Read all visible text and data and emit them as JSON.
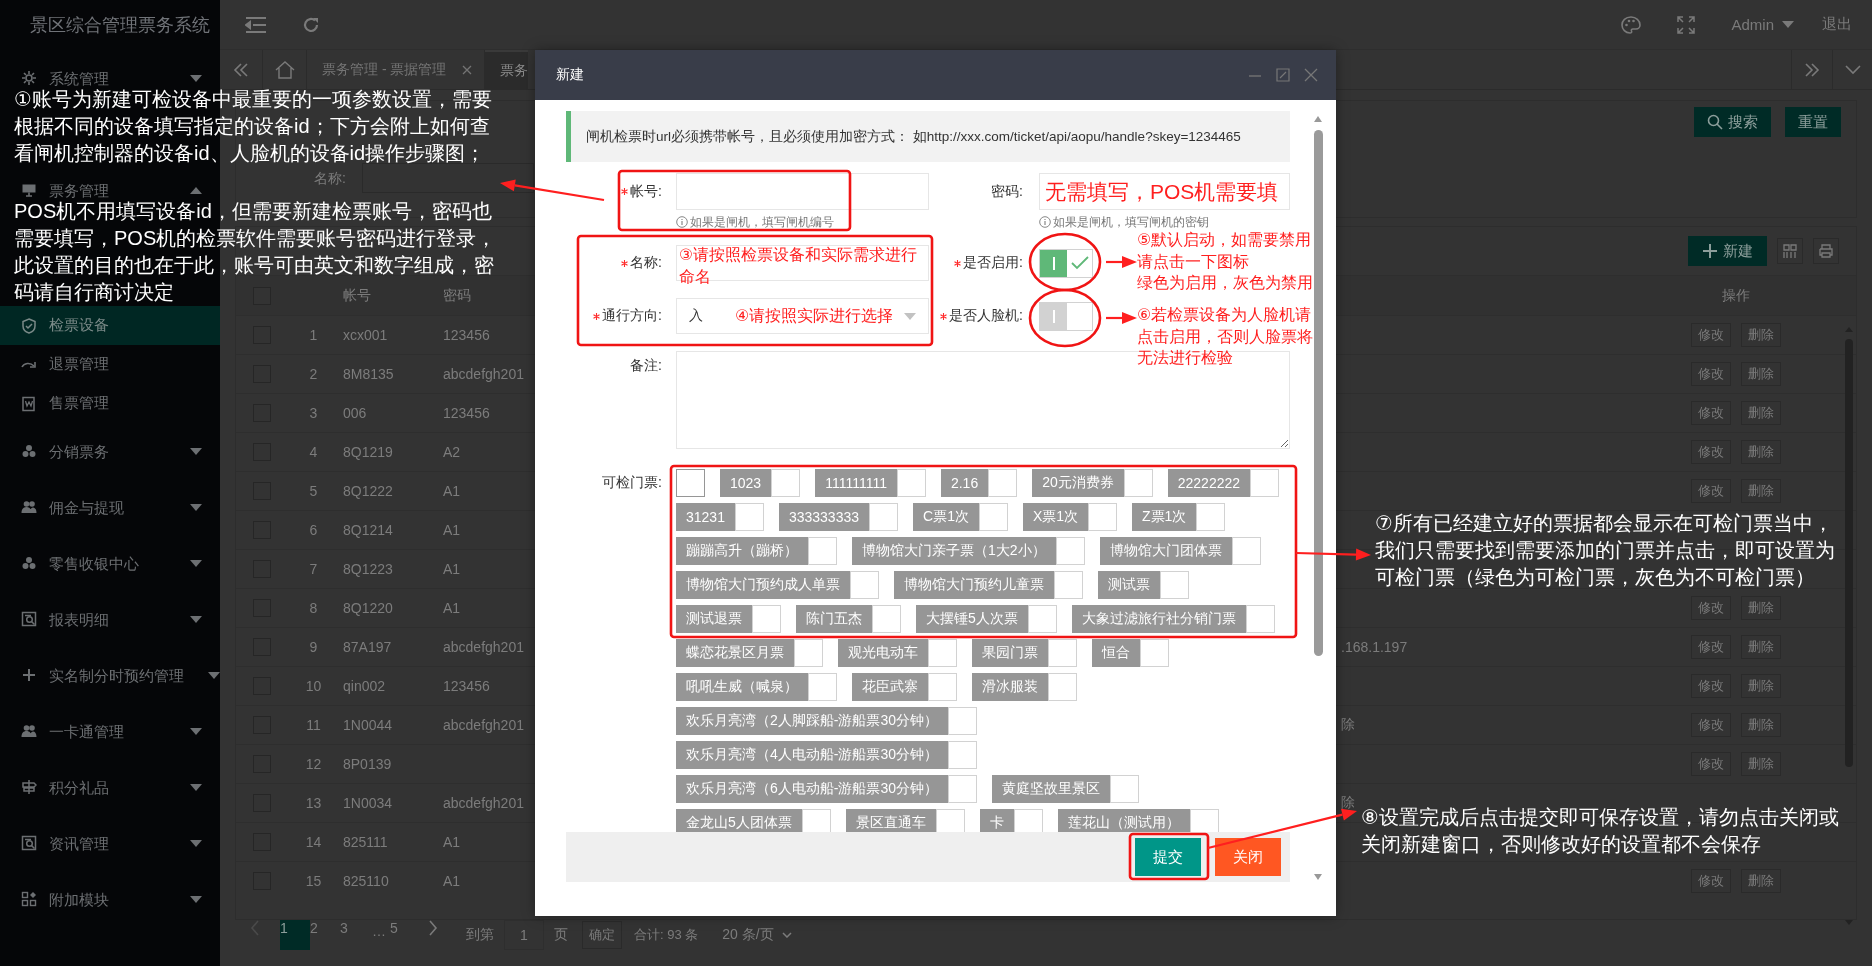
{
  "app": {
    "title": "景区综合管理票务系统"
  },
  "sidebar": {
    "items": [
      {
        "label": "系统管理",
        "expanded": false,
        "selected": false
      },
      {
        "label": "票务管理",
        "expanded": true,
        "selected": false,
        "children": [
          {
            "label": "检票设备",
            "selected": true
          },
          {
            "label": "退票管理",
            "selected": false
          },
          {
            "label": "售票管理",
            "selected": false
          }
        ]
      },
      {
        "label": "分销票务",
        "expanded": false,
        "selected": false
      },
      {
        "label": "佣金与提现",
        "expanded": false,
        "selected": false
      },
      {
        "label": "零售收银中心",
        "expanded": false,
        "selected": false
      },
      {
        "label": "报表明细",
        "expanded": false,
        "selected": false
      },
      {
        "label": "实名制分时预约管理",
        "expanded": false,
        "selected": false
      },
      {
        "label": "一卡通管理",
        "expanded": false,
        "selected": false
      },
      {
        "label": "积分礼品",
        "expanded": false,
        "selected": false
      },
      {
        "label": "资讯管理",
        "expanded": false,
        "selected": false
      },
      {
        "label": "附加模块",
        "expanded": false,
        "selected": false
      }
    ]
  },
  "header": {
    "user": "Admin",
    "logout": "退出"
  },
  "tabs": [
    {
      "label": "票务管理 - 票据管理",
      "selected": false
    },
    {
      "label": "票务",
      "selected": true
    }
  ],
  "search": {
    "label": "名称:",
    "buttons": [
      "搜索",
      "重置"
    ]
  },
  "toolbar": {
    "new_button": "新建"
  },
  "table": {
    "columns": [
      "帐号",
      "密码",
      "操作"
    ],
    "all_checked": false,
    "rows": [
      {
        "index": "1",
        "account": "xcx001",
        "password": "123456",
        "checked": false,
        "actions": [
          "修改",
          "删除"
        ]
      },
      {
        "index": "2",
        "account": "8M8135",
        "password": "abcdefgh201",
        "checked": false,
        "actions": [
          "修改",
          "删除"
        ]
      },
      {
        "index": "3",
        "account": "006",
        "password": "123456",
        "checked": false,
        "actions": [
          "修改",
          "删除"
        ]
      },
      {
        "index": "4",
        "account": "8Q1219",
        "password": "A2",
        "checked": false,
        "actions": [
          "修改",
          "删除"
        ]
      },
      {
        "index": "5",
        "account": "8Q1222",
        "password": "A1",
        "checked": false,
        "actions": [
          "修改",
          "删除"
        ]
      },
      {
        "index": "6",
        "account": "8Q1214",
        "password": "A1",
        "checked": false
      },
      {
        "index": "7",
        "account": "8Q1223",
        "password": "A1",
        "checked": false
      },
      {
        "index": "8",
        "account": "8Q1220",
        "password": "A1",
        "checked": false,
        "actions": [
          "修改",
          "删除"
        ]
      },
      {
        "index": "9",
        "account": "87A197",
        "password": "abcdefgh201",
        "column_5": ".168.1.197",
        "checked": false,
        "actions": [
          "修改",
          "删除"
        ]
      },
      {
        "index": "10",
        "account": "qin002",
        "password": "123456",
        "checked": false,
        "actions": [
          "修改",
          "删除"
        ]
      },
      {
        "index": "11",
        "account": "1N0044",
        "password": "abcdefgh201",
        "column_5": "除",
        "checked": false,
        "actions": [
          "修改",
          "删除"
        ]
      },
      {
        "index": "12",
        "account": "8P0139",
        "checked": false,
        "actions": [
          "修改",
          "删除"
        ]
      },
      {
        "index": "13",
        "account": "1N0034",
        "password": "abcdefgh201",
        "column_5": "除",
        "checked": false
      },
      {
        "index": "14",
        "account": "825111",
        "password": "A1",
        "checked": false
      },
      {
        "index": "15",
        "account": "825110",
        "password": "A1",
        "checked": false,
        "actions": [
          "修改",
          "删除"
        ]
      }
    ]
  },
  "pagination": {
    "pages": [
      {
        "label": "1",
        "kind": "page",
        "selected": true
      },
      {
        "label": "2",
        "kind": "page",
        "selected": false
      },
      {
        "label": "3",
        "kind": "page",
        "selected": false
      },
      {
        "label": "…",
        "kind": "ellipsis",
        "selected": false
      },
      {
        "label": "5",
        "kind": "page",
        "selected": false
      }
    ],
    "goto_label": "到第",
    "goto_value": "1",
    "goto_unit": "页",
    "confirm": "确定",
    "total": "合计: 93 条",
    "page_size": "20 条/页"
  },
  "dialog": {
    "title": "新建",
    "notice": "闸机检票时url必须携带帐号，且必须使用加密方式： 如http://xxx.com/ticket/api/aopu/handle?skey=1234465",
    "account": {
      "label": "帐号:",
      "required": true,
      "hint": "如果是闸机，填写闸机编号"
    },
    "password": {
      "label": "密码:",
      "required": false,
      "hint": "如果是闸机，填写闸机的密钥",
      "note": "无需填写，POS机需要填"
    },
    "name": {
      "label": "名称:",
      "required": true,
      "note": "③请按照检票设备和实际需求进行命名"
    },
    "direction": {
      "label": "通行方向:",
      "required": true,
      "value": "入",
      "note": "④请按照实际进行选择"
    },
    "enabled": {
      "label": "是否启用:",
      "required": true,
      "on": true
    },
    "face": {
      "label": "是否人脸机:",
      "required": true,
      "on": false
    },
    "remark": {
      "label": "备注:"
    },
    "tickets": {
      "label": "可检门票:",
      "items": [
        {
          "selected": false
        },
        {
          "name": "1023",
          "selected": false
        },
        {
          "name": "111111111",
          "selected": false
        },
        {
          "name": "2.16",
          "selected": false
        },
        {
          "name": "20元消费券",
          "selected": false
        },
        {
          "name": "22222222",
          "selected": false
        },
        {
          "name": "31231",
          "selected": false
        },
        {
          "name": "333333333",
          "selected": false
        },
        {
          "name": "C票1次",
          "selected": false
        },
        {
          "name": "X票1次",
          "selected": false
        },
        {
          "name": "Z票1次",
          "selected": false
        },
        {
          "name": "蹦蹦高升（蹦桥）",
          "selected": false
        },
        {
          "name": "博物馆大门亲子票（1大2小）",
          "selected": false
        },
        {
          "name": "博物馆大门团体票",
          "selected": false
        },
        {
          "name": "博物馆大门预约成人单票",
          "selected": false
        },
        {
          "name": "博物馆大门预约儿童票",
          "selected": false
        },
        {
          "name": "测试票",
          "selected": false
        },
        {
          "name": "测试退票",
          "selected": false
        },
        {
          "name": "陈门五杰",
          "selected": false
        },
        {
          "name": "大摆锤5人次票",
          "selected": false
        },
        {
          "name": "大象过滤旅行社分销门票",
          "selected": false
        },
        {
          "name": "蝶恋花景区月票",
          "selected": false
        },
        {
          "name": "观光电动车",
          "selected": false
        },
        {
          "name": "果园门票",
          "selected": false
        },
        {
          "name": "恒合",
          "selected": false
        },
        {
          "name": "吼吼生威（喊泉）",
          "selected": false
        },
        {
          "name": "花臣武寨",
          "selected": false
        },
        {
          "name": "滑冰服装",
          "selected": false
        },
        {
          "name": "欢乐月亮湾（2人脚踩船-游船票30分钟）",
          "selected": false
        },
        {
          "name": "欢乐月亮湾（4人电动船-游船票30分钟）",
          "selected": false
        },
        {
          "name": "欢乐月亮湾（6人电动船-游船票30分钟）",
          "selected": false
        },
        {
          "name": "黄庭坚故里景区",
          "selected": false
        },
        {
          "name": "金龙山5人团体票",
          "selected": false
        },
        {
          "name": "景区直通车",
          "selected": false
        },
        {
          "name": "卡",
          "selected": false
        },
        {
          "name": "莲花山（测试用）",
          "selected": false
        }
      ]
    },
    "buttons": [
      {
        "label": "提交",
        "kind": "primary"
      },
      {
        "label": "关闭",
        "kind": "danger"
      }
    ]
  },
  "annotations": [
    {
      "kind": "caption",
      "lines": [
        "①账号为新建可检设备中最重要的一项参数设置，需要",
        "根据不同的设备填写指定的设备id；下方会附上如何查",
        "看闸机控制器的设备id、人脸机的设备id操作步骤图；"
      ]
    },
    {
      "kind": "caption",
      "lines": [
        "POS机不用填写设备id，但需要新建检票账号，密码也",
        "需要填写，POS机的检票软件需要账号密码进行登录，",
        "此设置的目的也在于此，账号可由英文和数字组成，密",
        "码请自行商讨决定"
      ]
    },
    {
      "kind": "remark",
      "lines": [
        "⑤默认启动，如需要禁用",
        "请点击一下图标",
        "绿色为启用，灰色为禁用"
      ]
    },
    {
      "kind": "remark",
      "lines": [
        "⑥若检票设备为人脸机请",
        "点击启用，否则人脸票将",
        "无法进行检验"
      ]
    },
    {
      "kind": "caption",
      "lines": [
        "⑦所有已经建立好的票据都会显示在可检门票当中，",
        "我们只需要找到需要添加的门票并点击，即可设置为",
        "可检门票（绿色为可检门票，灰色为不可检门票）"
      ]
    },
    {
      "kind": "caption",
      "lines": [
        "⑧设置完成后点击提交即可保存设置，请勿点击关闭或",
        "关闭新建窗口，否则修改好的设置都不会保存"
      ]
    }
  ]
}
